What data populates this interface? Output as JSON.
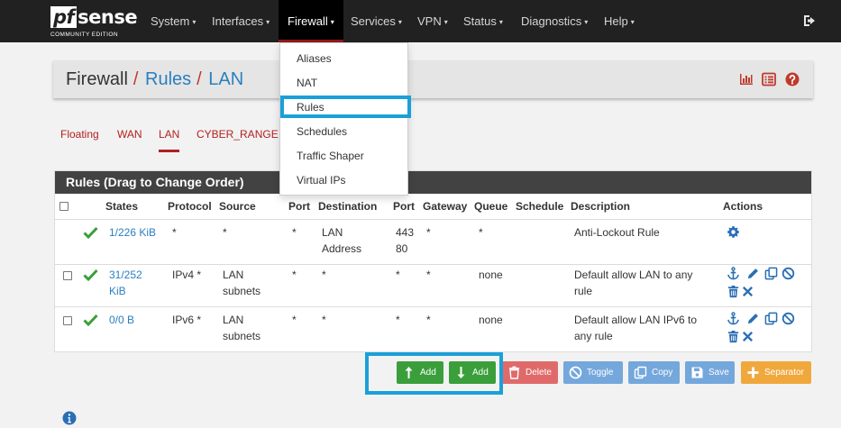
{
  "logo": {
    "prefix": "pf",
    "main": "sense",
    "edition": "COMMUNITY EDITION"
  },
  "nav": {
    "items": [
      {
        "label": "System"
      },
      {
        "label": "Interfaces"
      },
      {
        "label": "Firewall"
      },
      {
        "label": "Services"
      },
      {
        "label": "VPN"
      },
      {
        "label": "Status"
      },
      {
        "label": "Diagnostics"
      },
      {
        "label": "Help"
      }
    ],
    "active": "Firewall",
    "caret": "▾"
  },
  "firewall_menu": {
    "items": [
      {
        "label": "Aliases"
      },
      {
        "label": "NAT"
      },
      {
        "label": "Rules"
      },
      {
        "label": "Schedules"
      },
      {
        "label": "Traffic Shaper"
      },
      {
        "label": "Virtual IPs"
      }
    ],
    "highlighted": "Rules"
  },
  "breadcrumb": {
    "part1": "Firewall",
    "sep": "/",
    "part2": "Rules",
    "part3": "LAN"
  },
  "tabs": [
    {
      "label": "Floating"
    },
    {
      "label": "WAN"
    },
    {
      "label": "LAN"
    },
    {
      "label": "CYBER_RANGE"
    }
  ],
  "active_tab": "LAN",
  "panel": {
    "title": "Rules (Drag to Change Order)"
  },
  "table": {
    "headers": {
      "states": "States",
      "protocol": "Protocol",
      "source": "Source",
      "sport": "Port",
      "destination": "Destination",
      "dport": "Port",
      "gateway": "Gateway",
      "queue": "Queue",
      "schedule": "Schedule",
      "description": "Description",
      "actions": "Actions"
    },
    "rows": [
      {
        "states": [
          "1/226 KiB"
        ],
        "protocol": "*",
        "source": [
          "*"
        ],
        "sport": "*",
        "destination": [
          "*"
        ],
        "dest_top": [
          "LAN",
          "Address"
        ],
        "dport": [
          "443",
          "80"
        ],
        "gateway": "*",
        "queue": "*",
        "description": [
          "Anti-Lockout Rule"
        ]
      },
      {
        "states": [
          "31/252",
          "KiB"
        ],
        "protocol": "IPv4 *",
        "source": [
          "LAN",
          "subnets"
        ],
        "sport": "*",
        "destination": [
          "*"
        ],
        "dport": [
          "*"
        ],
        "gateway": "*",
        "queue": "none",
        "description": [
          "Default allow LAN to any",
          "rule"
        ]
      },
      {
        "states": [
          "0/0 B"
        ],
        "protocol": "IPv6 *",
        "source": [
          "LAN",
          "subnets"
        ],
        "sport": "*",
        "destination": [
          "*"
        ],
        "dport": [
          "*"
        ],
        "gateway": "*",
        "queue": "none",
        "description": [
          "Default allow LAN IPv6 to",
          "any rule"
        ]
      }
    ]
  },
  "buttons": {
    "add_top": "Add",
    "add_bottom": "Add",
    "delete": "Delete",
    "toggle": "Toggle",
    "copy": "Copy",
    "save": "Save",
    "separator": "Separator"
  },
  "colors": {
    "navbar": "#212121",
    "link_red": "#b32020",
    "link_blue": "#2a7fbf",
    "highlight": "#1aa0d8",
    "pass_green": "#3a9f3a",
    "delete_red": "#e06a6a",
    "action_blue": "#2a6fb5"
  },
  "icons": {
    "logout": "sign-out-icon",
    "breadcrumb": [
      "chart-icon",
      "list-icon",
      "help-icon"
    ],
    "rule_pass": "check-icon",
    "row_actions": [
      "anchor-icon",
      "pencil-icon",
      "copy-icon",
      "disable-icon",
      "trash-icon",
      "times-icon"
    ],
    "gear": "gear-icon",
    "info": "info-icon"
  }
}
